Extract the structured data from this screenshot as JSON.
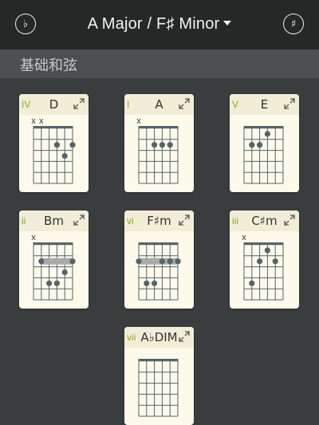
{
  "header": {
    "flat_label": "♭",
    "sharp_label": "♯",
    "key_title": "A Major / F♯ Minor"
  },
  "section": {
    "title": "基础和弦"
  },
  "colors": {
    "topbar": "#262828",
    "background": "#3a3d3d",
    "section_bar": "#4b4f4f",
    "card": "#fdfaec",
    "card_header": "#f2edd6",
    "degree": "#8aac25",
    "diagram": "#546469",
    "barre": "#a7acaa"
  },
  "chords": [
    {
      "degree": "IV",
      "name": "D",
      "muted": [
        6,
        5
      ],
      "dots": [
        [
          3,
          2
        ],
        [
          2,
          3
        ],
        [
          1,
          2
        ]
      ],
      "barre": null
    },
    {
      "degree": "I",
      "name": "A",
      "muted": [
        6
      ],
      "dots": [
        [
          4,
          2
        ],
        [
          3,
          2
        ],
        [
          2,
          2
        ]
      ],
      "barre": null
    },
    {
      "degree": "V",
      "name": "E",
      "muted": [],
      "dots": [
        [
          5,
          2
        ],
        [
          4,
          2
        ],
        [
          3,
          1
        ]
      ],
      "barre": null
    },
    {
      "degree": "ii",
      "name": "Bm",
      "muted": [
        6
      ],
      "dots": [
        [
          5,
          2
        ],
        [
          1,
          2
        ],
        [
          4,
          4
        ],
        [
          3,
          4
        ],
        [
          2,
          3
        ]
      ],
      "barre": {
        "fret": 2,
        "from": 5,
        "to": 1
      }
    },
    {
      "degree": "vi",
      "name": "F♯m",
      "muted": [],
      "dots": [
        [
          6,
          2
        ],
        [
          3,
          2
        ],
        [
          2,
          2
        ],
        [
          1,
          2
        ],
        [
          5,
          4
        ],
        [
          4,
          4
        ]
      ],
      "barre": {
        "fret": 2,
        "from": 6,
        "to": 1
      }
    },
    {
      "degree": "iii",
      "name": "C♯m",
      "muted": [
        6
      ],
      "dots": [
        [
          3,
          1
        ],
        [
          4,
          2
        ],
        [
          2,
          2
        ],
        [
          5,
          4
        ]
      ],
      "barre": null
    },
    {
      "degree": "vii",
      "name": "A♭DIM",
      "muted": [],
      "dots": [],
      "barre": null
    }
  ]
}
